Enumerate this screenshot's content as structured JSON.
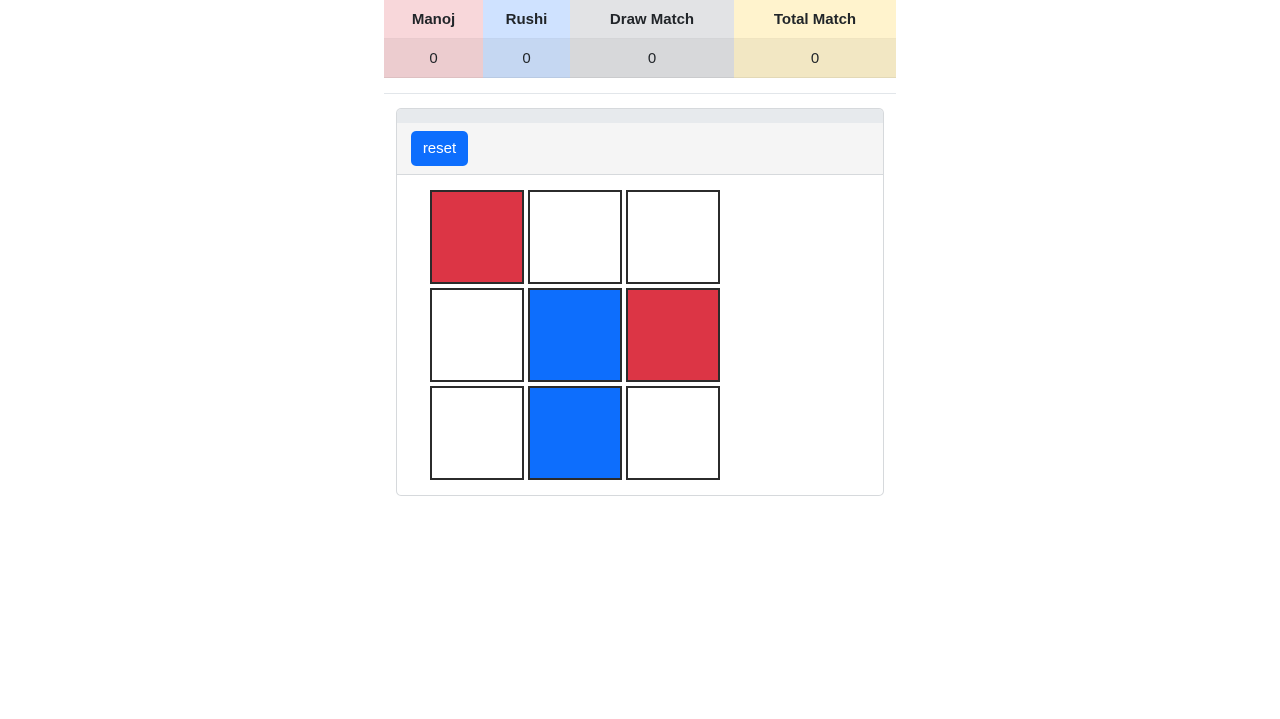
{
  "scoreboard": {
    "headers": [
      "Manoj",
      "Rushi",
      "Draw Match",
      "Total Match"
    ],
    "values": [
      "0",
      "0",
      "0",
      "0"
    ],
    "header_colors": [
      "#f8d7da",
      "#cfe2ff",
      "#e2e3e5",
      "#fff3cd"
    ],
    "value_colors": [
      "#eccccf",
      "#c5d7f2",
      "#d7d8da",
      "#f2e7c3"
    ]
  },
  "controls": {
    "reset_label": "reset"
  },
  "board": {
    "cells": [
      "red",
      "empty",
      "empty",
      "empty",
      "blue",
      "red",
      "empty",
      "blue",
      "empty"
    ],
    "colors": {
      "red": "#dc3545",
      "blue": "#0d6efd",
      "empty": "#ffffff"
    }
  }
}
